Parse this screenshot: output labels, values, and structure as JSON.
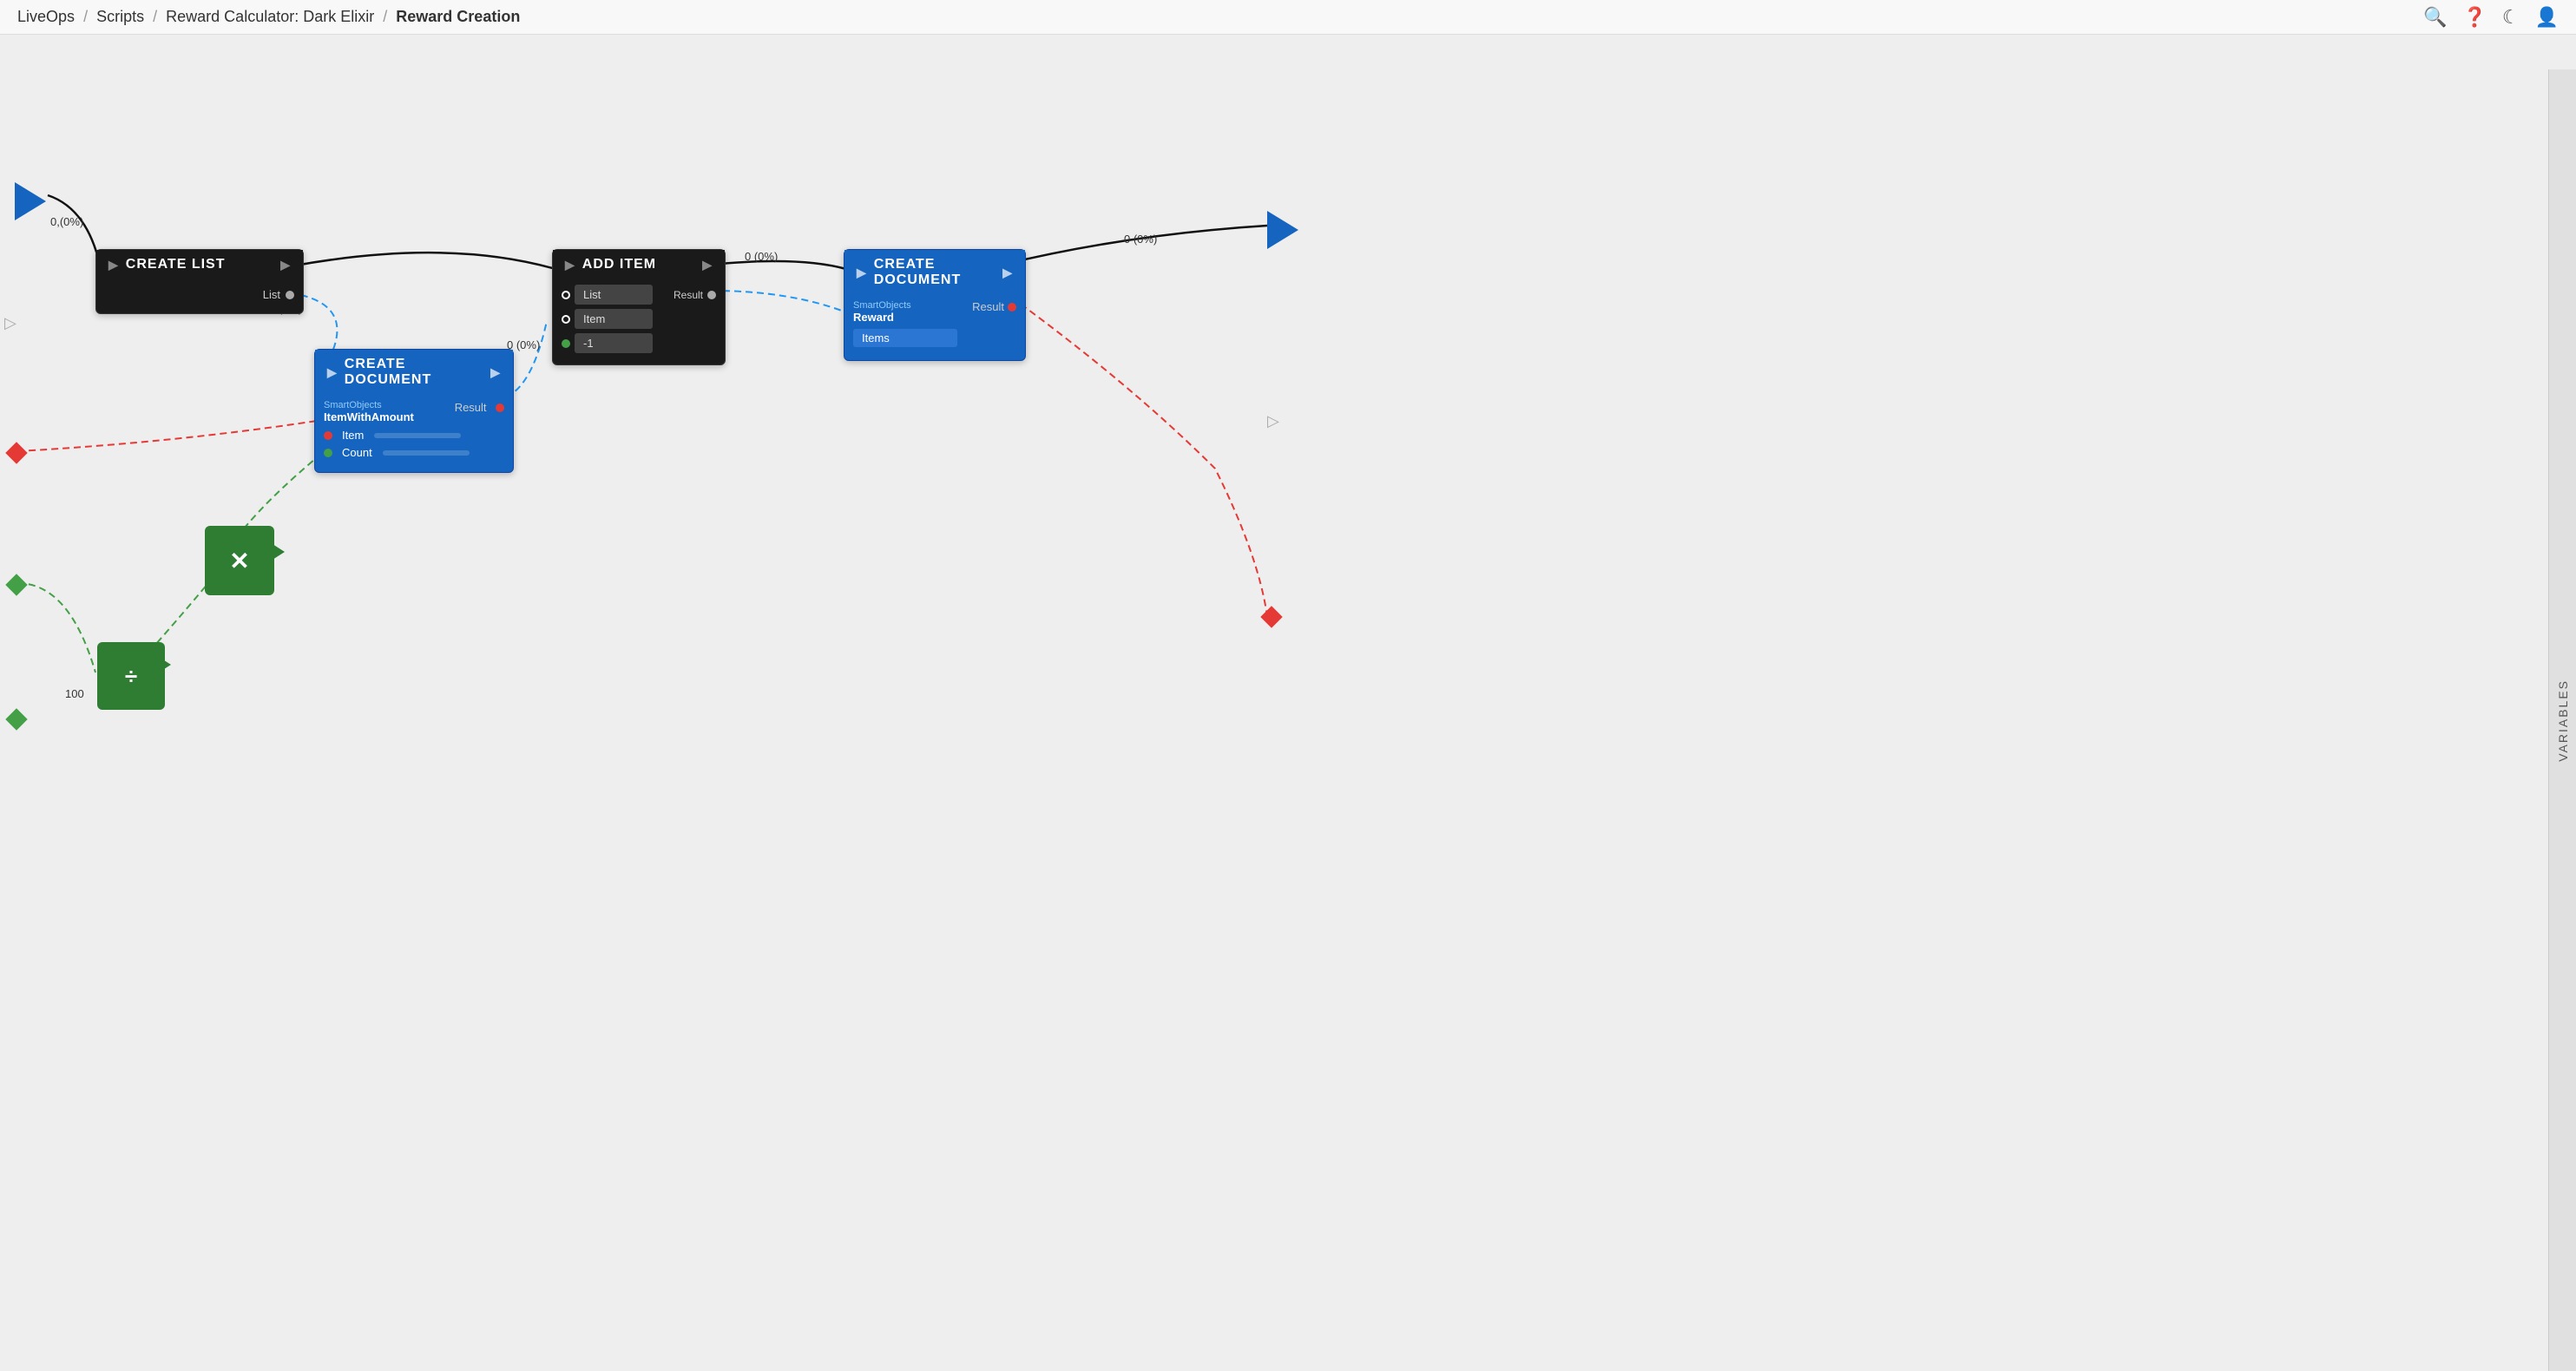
{
  "header": {
    "breadcrumb": "LiveOps / Scripts / Reward Calculator: Dark Elixir / Reward Creation",
    "parts": [
      "LiveOps",
      "Scripts",
      "Reward Calculator: Dark Elixir",
      "Reward Creation"
    ]
  },
  "icons": {
    "search": "🔍",
    "help": "❓",
    "theme": "🌙",
    "user": "👤"
  },
  "sidebar": {
    "label": "VARIABLES"
  },
  "nodes": {
    "start_arrow": {
      "label": ""
    },
    "create_list": {
      "title": "CREATE LIST",
      "output": "List"
    },
    "create_document_1": {
      "title": "CREATE DOCUMENT",
      "type": "SmartObjects",
      "subtype": "ItemWithAmount",
      "result": "Result",
      "fields": [
        {
          "name": "Item",
          "value": ""
        },
        {
          "name": "Count",
          "value": ""
        }
      ]
    },
    "add_item": {
      "title": "ADD ITEM",
      "result": "Result",
      "fields": [
        {
          "name": "List",
          "value": ""
        },
        {
          "name": "Item",
          "value": ""
        },
        {
          "name": "",
          "value": "-1"
        }
      ]
    },
    "create_document_2": {
      "title": "CREATE DOCUMENT",
      "type": "SmartObjects",
      "subtype": "Reward",
      "result": "Result",
      "fields": [
        {
          "name": "Items",
          "value": ""
        }
      ]
    }
  },
  "labels": {
    "count_0pct_left": "0,(0%)",
    "count_0pct_mid1": "0 (0%)",
    "count_0pct_mid2": "0 (0%)",
    "count_0pct_right": "0 (0%)",
    "count_100": "100"
  }
}
